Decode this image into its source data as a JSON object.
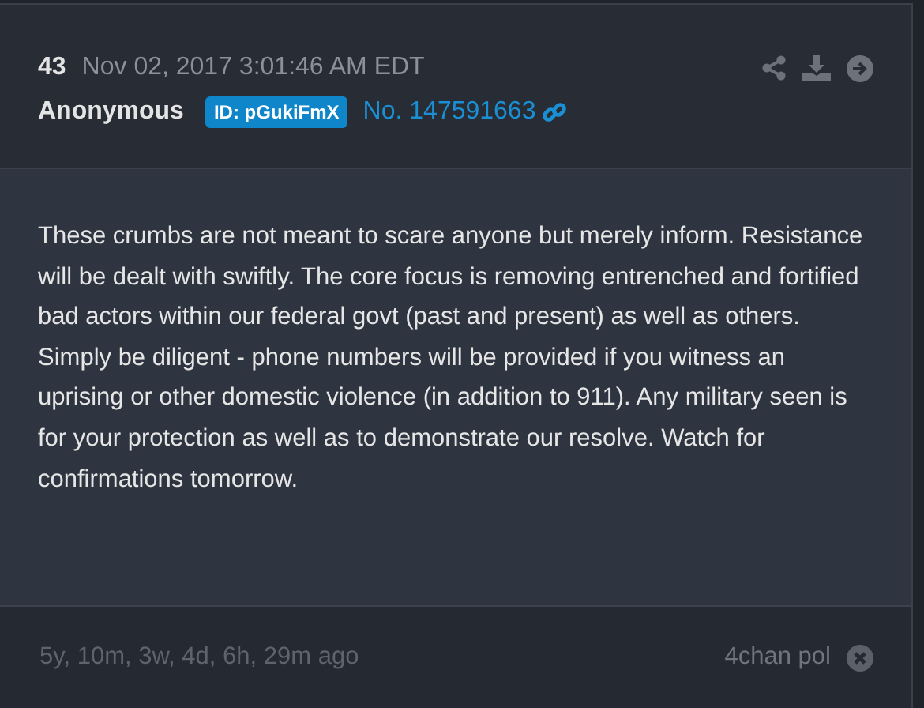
{
  "post": {
    "number": "43",
    "timestamp": "Nov 02, 2017 3:01:46 AM EDT",
    "author": "Anonymous",
    "id_badge": "ID: pGukiFmX",
    "post_link": "No. 147591663",
    "body": "These crumbs are not meant to scare anyone but merely inform. Resistance will be dealt with swiftly. The core focus is removing entrenched and fortified bad actors within our federal govt (past and present) as well as others. Simply be diligent - phone numbers will be provided if you witness an uprising or other domestic violence (in addition to 911). Any military seen is for your protection as well as to demonstrate our resolve. Watch for confirmations tomorrow.",
    "age": "5y, 10m, 3w, 4d, 6h, 29m ago",
    "source": "4chan pol"
  }
}
